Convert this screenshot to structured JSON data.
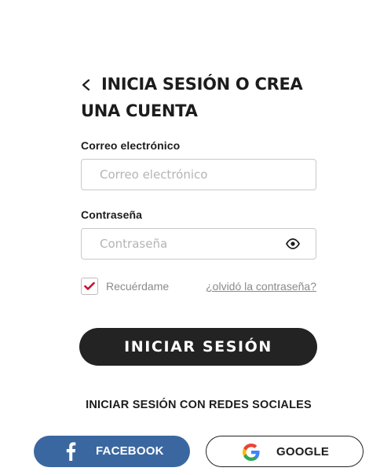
{
  "header": {
    "back_icon": "chevron-left-icon",
    "title": "INICIA SESIÓN O CREA UNA CUENTA"
  },
  "form": {
    "email": {
      "label": "Correo electrónico",
      "placeholder": "Correo electrónico",
      "value": ""
    },
    "password": {
      "label": "Contraseña",
      "placeholder": "Contraseña",
      "value": "",
      "toggle_icon": "eye-icon"
    },
    "remember": {
      "label": "Recuérdame",
      "checked": true,
      "check_color": "#c8102e"
    },
    "forgot_label": "¿olvidó la contraseña?",
    "submit_label": "INICIAR SESIÓN"
  },
  "social": {
    "heading": "INICIAR SESIÓN CON REDES SOCIALES",
    "facebook": {
      "label": "FACEBOOK",
      "icon": "facebook-icon",
      "color": "#3b67a0"
    },
    "google": {
      "label": "GOOGLE",
      "icon": "google-icon"
    }
  }
}
